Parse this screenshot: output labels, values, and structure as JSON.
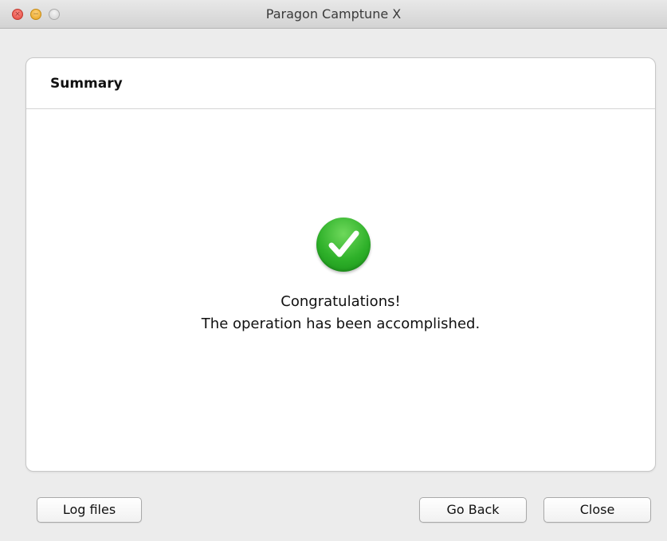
{
  "window": {
    "title": "Paragon Camptune X"
  },
  "panel": {
    "heading": "Summary",
    "status_icon": "check-circle-icon",
    "message_line1": "Congratulations!",
    "message_line2": "The operation has been accomplished."
  },
  "footer": {
    "log_files_label": "Log files",
    "go_back_label": "Go Back",
    "close_label": "Close"
  },
  "colors": {
    "success_green": "#2fb12a",
    "close_light": "#e0443b",
    "minimize_light": "#e5a01d"
  }
}
